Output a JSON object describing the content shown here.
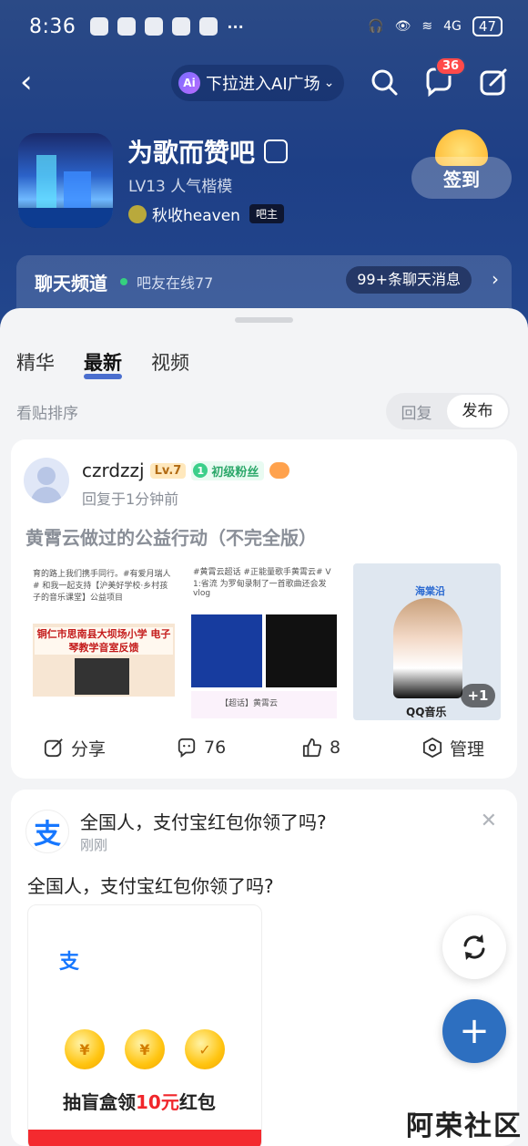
{
  "status": {
    "time": "8:36",
    "battery": "47",
    "signal": "4G"
  },
  "nav": {
    "ai_label": "下拉进入AI广场",
    "ai_badge": "Ai",
    "msg_badge": "36"
  },
  "bar": {
    "title": "为歌而赞吧",
    "level": "LV13 人气楷模",
    "owner_name": "秋收heaven",
    "owner_tag": "吧主",
    "sign_label": "签到"
  },
  "chat": {
    "title": "聊天频道",
    "online": "吧友在线77",
    "messages": "99+条聊天消息"
  },
  "tabs": [
    "精华",
    "最新",
    "视频"
  ],
  "sort": {
    "label": "看贴排序",
    "opt1": "回复",
    "opt2": "发布"
  },
  "post": {
    "user": "czrdzzj",
    "level": "Lv.7",
    "fan_num": "1",
    "fan_label": "初级粉丝",
    "time": "回复于1分钟前",
    "title": "黄霄云做过的公益行动（不完全版）",
    "img1_text": "育的路上我们携手同行。#有爱月瑞人# 和我一起支持【沪美好学校·乡村孩子的音乐课堂】公益项目",
    "img1_banner": "铜仁市思南县大坝场小学 电子琴教学音室反馈",
    "img2_text": "#黄霄云超话 #正能量歌手黄霄云# V 1:省流 为罗甸录制了一首歌曲还会发vlog",
    "img2_foot": "【超话】黄霄云",
    "img3_name": "海棠沿",
    "img3_brand": "QQ音乐",
    "more": "+1",
    "share": "分享",
    "comments": "76",
    "likes": "8",
    "manage": "管理"
  },
  "ad": {
    "logo": "支",
    "title": "全国人，支付宝红包你领了吗?",
    "time": "刚刚",
    "body": "全国人，支付宝红包你领了吗?",
    "coin_symbol": "¥",
    "caption_pre": "抽盲盒领",
    "caption_amount": "10元",
    "caption_post": "红包"
  },
  "watermark": "阿荣社区"
}
